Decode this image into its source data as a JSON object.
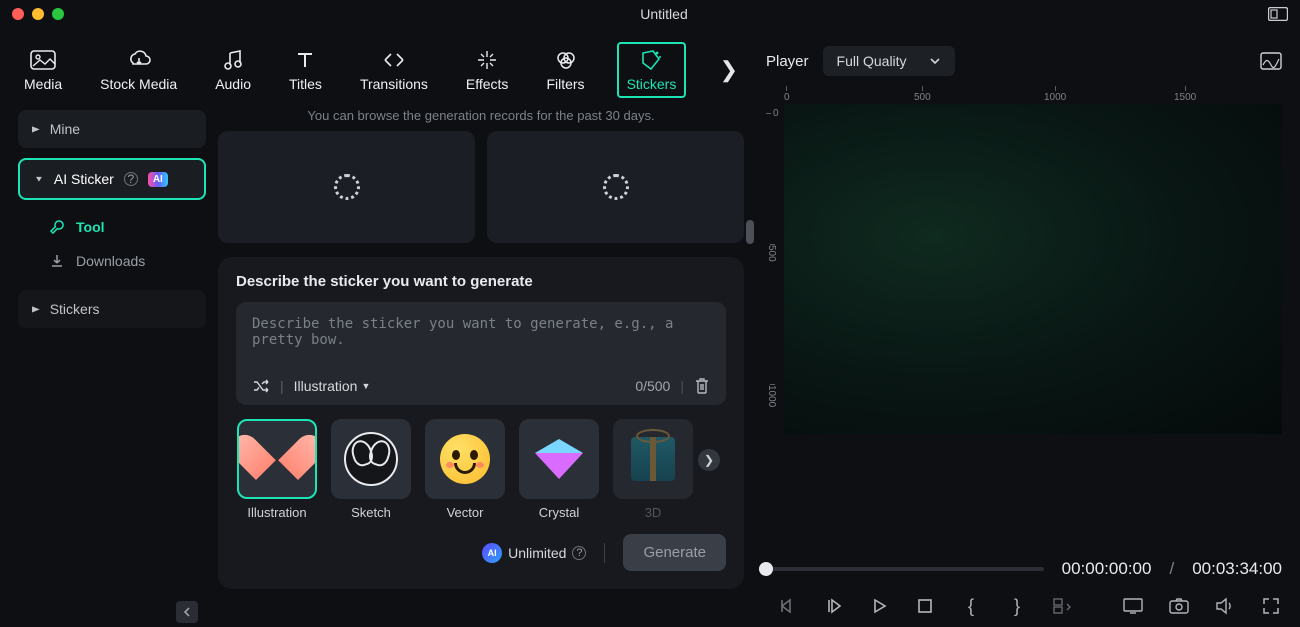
{
  "window": {
    "title": "Untitled"
  },
  "tabs": {
    "items": [
      "Media",
      "Stock Media",
      "Audio",
      "Titles",
      "Transitions",
      "Effects",
      "Filters",
      "Stickers"
    ],
    "active": "Stickers"
  },
  "sidebar": {
    "mine": "Mine",
    "ai_sticker": "AI Sticker",
    "ai_badge": "AI",
    "tool": "Tool",
    "downloads": "Downloads",
    "stickers": "Stickers"
  },
  "records": {
    "note": "You can browse the generation records for the past 30 days."
  },
  "panel": {
    "heading": "Describe the sticker you want to generate",
    "placeholder": "Describe the sticker you want to generate, e.g., a pretty bow.",
    "style_label": "Illustration",
    "counter": "0/500",
    "styles": [
      "Illustration",
      "Sketch",
      "Vector",
      "Crystal",
      "3D"
    ],
    "unlimited": "Unlimited",
    "generate": "Generate"
  },
  "player": {
    "label": "Player",
    "quality": "Full Quality",
    "h_ticks": [
      "0",
      "500",
      "1000",
      "1500"
    ],
    "v_ticks": [
      "0",
      "500",
      "1000"
    ],
    "time_current": "00:00:00:00",
    "time_total": "00:03:34:00"
  }
}
